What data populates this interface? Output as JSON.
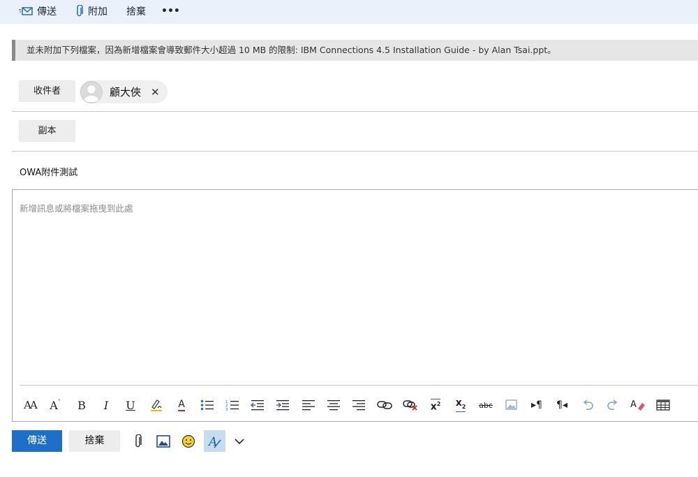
{
  "toolbar": {
    "send_label": "傳送",
    "attach_label": "附加",
    "discard_label": "捨棄",
    "more_label": "•••"
  },
  "notice": {
    "text": "並未附加下列檔案，因為新增檔案會導致郵件大小超過 10 MB 的限制: IBM Connections 4.5 Installation Guide - by Alan Tsai.ppt。"
  },
  "to": {
    "label": "收件者",
    "recipient_name": "顧大俠",
    "remove_label": "✕"
  },
  "cc": {
    "label": "副本"
  },
  "subject": {
    "value": "OWA附件測試"
  },
  "body": {
    "placeholder": "新增訊息或將檔案拖曳到此處"
  },
  "format_toolbar": {
    "font_size_label": "AA",
    "grow_font_label": "A",
    "bold_label": "B",
    "italic_label": "I",
    "underline_label": "U",
    "font_color_label": "A",
    "superscript_label": "x",
    "superscript_exp": "2",
    "subscript_label": "x",
    "subscript_exp": "2",
    "strike_label": "abc"
  },
  "footer": {
    "send_label": "傳送",
    "discard_label": "捨棄"
  },
  "colors": {
    "accent": "#1e6fc8",
    "topbar": "#eaf1fa",
    "font_color": "#d02020",
    "highlight": "#f0c000"
  }
}
